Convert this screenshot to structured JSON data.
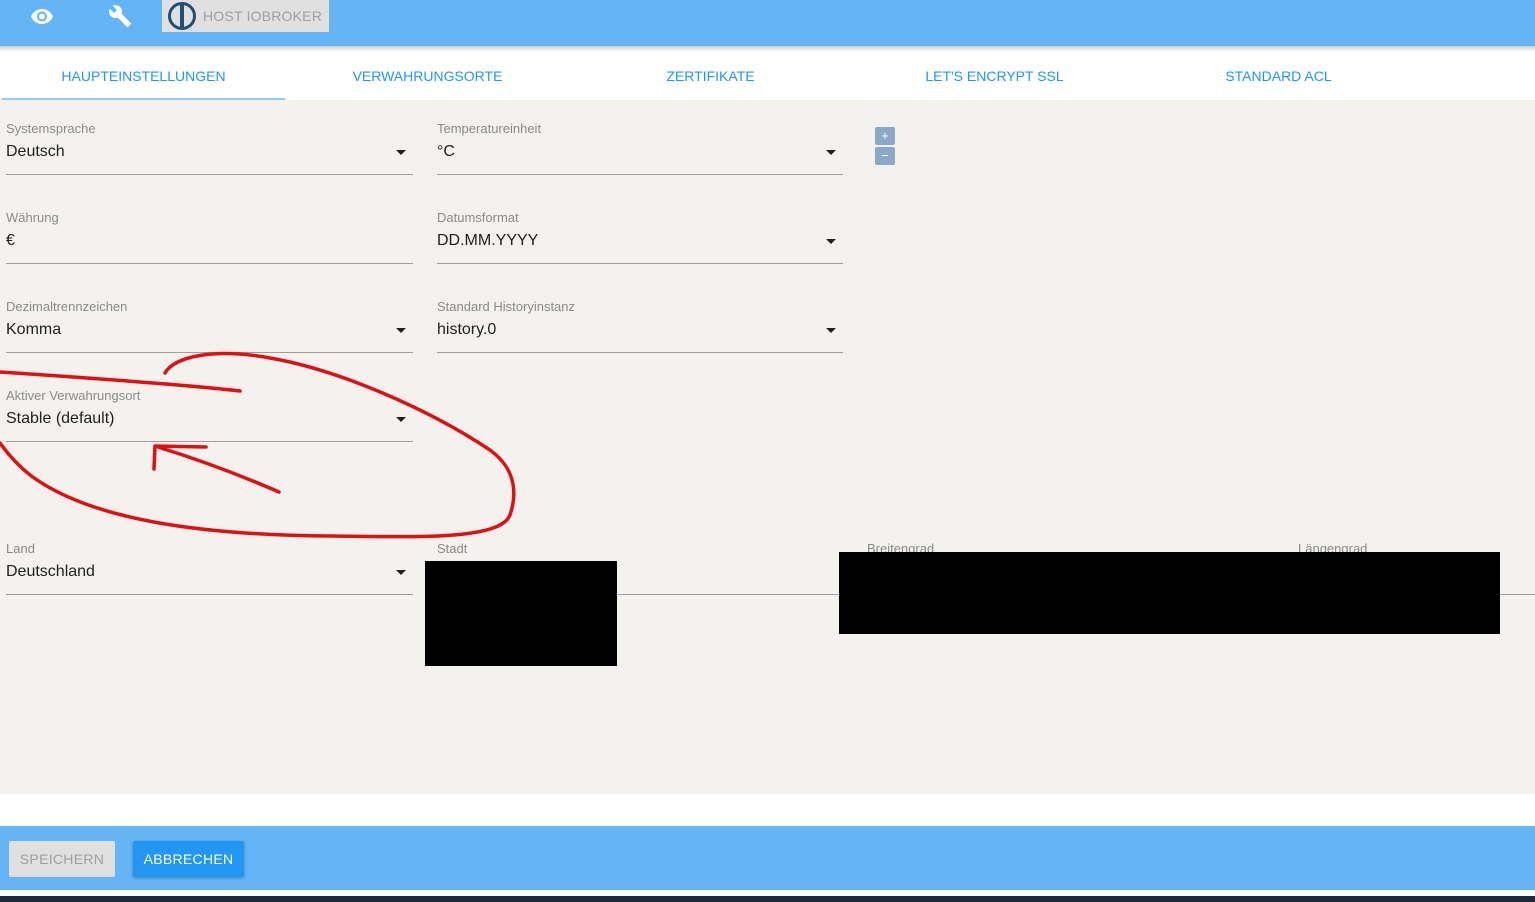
{
  "topbar": {
    "icons": [
      "eye-icon",
      "wrench-icon",
      "iobroker-logo-icon"
    ],
    "host_label": "HOST IOBROKER"
  },
  "tabs": [
    {
      "label": "HAUPTEINSTELLUNGEN",
      "active": true
    },
    {
      "label": "VERWAHRUNGSORTE",
      "active": false
    },
    {
      "label": "ZERTIFIKATE",
      "active": false
    },
    {
      "label": "LET'S ENCRYPT SSL",
      "active": false
    },
    {
      "label": "STANDARD ACL",
      "active": false
    }
  ],
  "settings": {
    "systemsprache": {
      "label": "Systemsprache",
      "value": "Deutsch"
    },
    "temperatureinheit": {
      "label": "Temperatureinheit",
      "value": "°C"
    },
    "waehrung": {
      "label": "Währung",
      "value": "€"
    },
    "datumsformat": {
      "label": "Datumsformat",
      "value": "DD.MM.YYYY"
    },
    "dezimaltrennzeichen": {
      "label": "Dezimaltrennzeichen",
      "value": "Komma"
    },
    "history": {
      "label": "Standard Historyinstanz",
      "value": "history.0"
    },
    "verwahrungsort": {
      "label": "Aktiver Verwahrungsort",
      "value": "Stable (default)"
    },
    "land": {
      "label": "Land",
      "value": "Deutschland"
    },
    "stadt": {
      "label": "Stadt",
      "value": ""
    },
    "breitengrad": {
      "label": "Breitengrad",
      "value": ""
    },
    "laengengrad": {
      "label": "Längengrad",
      "value": ""
    }
  },
  "map_zoom": {
    "plus": "+",
    "minus": "−"
  },
  "footer": {
    "save_label": "SPEICHERN",
    "cancel_label": "ABBRECHEN"
  },
  "colors": {
    "header_bg": "#64b5f6",
    "tab_text": "#2196f3",
    "content_bg": "#f4f2ef",
    "annotation": "#e01010",
    "cancel_bg": "#2196f3"
  }
}
